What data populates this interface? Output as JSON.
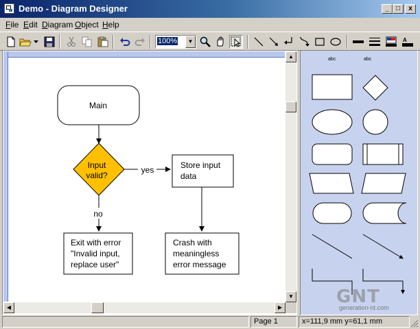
{
  "window": {
    "title": "Demo - Diagram Designer"
  },
  "caption_buttons": {
    "minimize": "_",
    "maximize": "□",
    "close": "x"
  },
  "menu": [
    {
      "label": "File",
      "mnemonic": "F",
      "rest": "ile"
    },
    {
      "label": "Edit",
      "mnemonic": "E",
      "rest": "dit"
    },
    {
      "label": "Diagram",
      "mnemonic": "D",
      "rest": "iagram"
    },
    {
      "label": "Object",
      "mnemonic": "O",
      "rest": "bject"
    },
    {
      "label": "Help",
      "mnemonic": "H",
      "rest": "elp"
    }
  ],
  "toolbar": {
    "zoom_value": "100%",
    "icons": [
      "new-file-icon",
      "open-folder-icon",
      "dropdown-arrow-icon",
      "save-disk-icon",
      "cut-icon",
      "copy-icon",
      "paste-icon",
      "undo-icon",
      "redo-icon",
      "zoom-icon",
      "pan-hand-icon",
      "select-pointer-icon",
      "line-icon",
      "arrow-line-icon",
      "connector-icon",
      "curve-icon",
      "rectangle-icon",
      "ellipse-icon",
      "line-width-icon",
      "line-style-icon",
      "fill-color-icon",
      "text-format-icon"
    ]
  },
  "diagram": {
    "nodes": {
      "main": "Main",
      "decision_line1": "Input",
      "decision_line2": "valid?",
      "store_line1": "Store input",
      "store_line2": "data",
      "exit_line1": "Exit with error",
      "exit_line2": "\"Invalid input,",
      "exit_line3": "replace user\"",
      "crash_line1": "Crash with",
      "crash_line2": "meaningless",
      "crash_line3": "error message"
    },
    "edges": {
      "yes": "yes",
      "no": "no"
    },
    "colors": {
      "decision_fill": "#ffc000",
      "canvas_border": "#b9c9ec"
    }
  },
  "palette": {
    "labels": [
      "abc",
      "abc"
    ],
    "shapes": [
      "process-box",
      "decision-diamond",
      "ellipse-wide",
      "circle",
      "rounded-rect",
      "predefined-process",
      "parallelogram-left",
      "parallelogram-right",
      "terminator",
      "stored-data",
      "line-shape",
      "arrow-shape",
      "elbow-connector",
      "elbow-arrow-connector"
    ],
    "background": "#c7d3ee"
  },
  "status": {
    "page": "Page 1",
    "x": "x=111,9 mm",
    "y": "y=61,1 mm"
  },
  "watermark": {
    "brand": "GNT",
    "site": "generation-nt.com"
  }
}
